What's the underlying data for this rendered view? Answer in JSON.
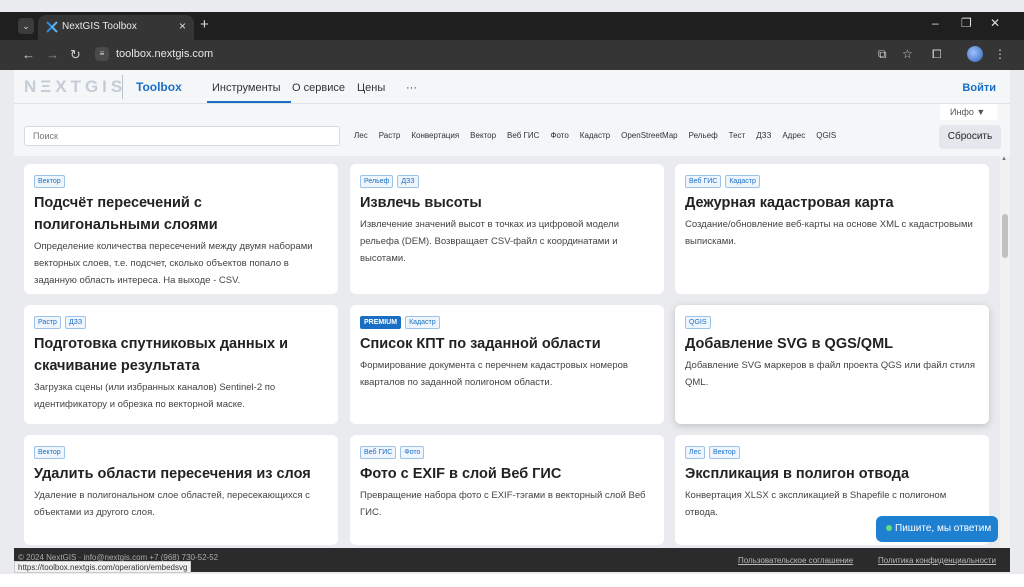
{
  "browser": {
    "tab_title": "NextGIS Toolbox",
    "new_tab": "+",
    "close_tab": "×",
    "url": "toolbox.nextgis.com",
    "window_controls": [
      "–",
      "❐",
      "✕"
    ]
  },
  "header": {
    "logo": "NΞXTGIS",
    "toolbox": "Toolbox",
    "nav": [
      "Инструменты",
      "О сервисе",
      "Цены",
      "···"
    ],
    "login": "Войти"
  },
  "filters": {
    "info": "Инфо ▼",
    "search_placeholder": "Поиск",
    "tags": [
      "Лес",
      "Растр",
      "Конвертация",
      "Вектор",
      "Веб ГИС",
      "Фото",
      "Кадастр",
      "OpenStreetMap",
      "Рельеф",
      "Тест",
      "ДЗЗ",
      "Адрес",
      "QGIS"
    ],
    "reset": "Сбросить"
  },
  "cards": [
    {
      "badges": [
        "Вектор"
      ],
      "title": "Подсчёт пересечений с полигональными слоями",
      "desc": "Определение количества пересечений между двумя наборами векторных слоев, т.е. подсчет, сколько объектов попало в заданную область интереса. На выходе - CSV."
    },
    {
      "badges": [
        "Рельеф",
        "ДЗЗ"
      ],
      "title": "Извлечь высоты",
      "desc": "Извлечение значений высот в точках из цифровой модели рельефа (DEM). Возвращает CSV-файл с координатами и высотами."
    },
    {
      "badges": [
        "Веб ГИС",
        "Кадастр"
      ],
      "title": "Дежурная кадастровая карта",
      "desc": "Создание/обновление веб-карты на основе XML с кадастровыми выписками."
    },
    {
      "badges": [
        "Растр",
        "ДЗЗ"
      ],
      "title": "Подготовка спутниковых данных и скачивание результата",
      "desc": "Загрузка сцены (или избранных каналов) Sentinel-2 по идентификатору и обрезка по векторной маске."
    },
    {
      "badges": [
        "PREMIUM",
        "Кадастр"
      ],
      "title": "Список КПТ по заданной области",
      "desc": "Формирование документа с перечнем кадастровых номеров кварталов по заданной полигоном области."
    },
    {
      "badges": [
        "QGIS"
      ],
      "title": "Добавление SVG в QGS/QML",
      "desc": "Добавление SVG маркеров в файл проекта QGS или файл стиля QML."
    },
    {
      "badges": [
        "Вектор"
      ],
      "title": "Удалить области пересечения из слоя",
      "desc": "Удаление в полигональном слое областей, пересекающихся с объектами из другого слоя."
    },
    {
      "badges": [
        "Веб ГИС",
        "Фото"
      ],
      "title": "Фото с EXIF в слой Веб ГИС",
      "desc": "Превращение набора фото с EXIF-тэгами в векторный слой Веб ГИС."
    },
    {
      "badges": [
        "Лес",
        "Вектор"
      ],
      "title": "Экспликация в полигон отвода",
      "desc": "Конвертация XLSX с экспликацией в Shapefile с полигоном отвода."
    }
  ],
  "chat": "Пишите, мы ответим",
  "footer": {
    "left": "© 2024 NextGIS  ·  info@nextgis.com +7 (968) 730-52-52",
    "links": [
      "Пользовательское соглашение",
      "Политика конфиденциальности"
    ],
    "status_url": "https://toolbox.nextgis.com/operation/embedsvg"
  }
}
